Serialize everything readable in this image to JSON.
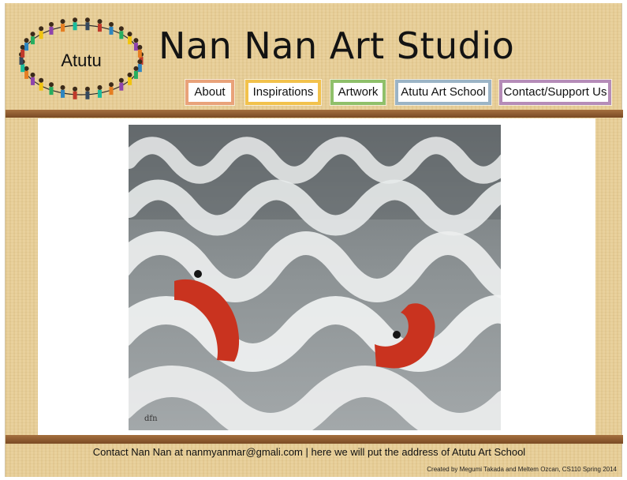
{
  "header": {
    "logo_text": "Atutu",
    "title": "Nan Nan Art Studio"
  },
  "nav": {
    "items": [
      {
        "label": "About",
        "color": "#e9a27a"
      },
      {
        "label": "Inspirations",
        "color": "#f2c24c"
      },
      {
        "label": "Artwork",
        "color": "#8fc06a"
      },
      {
        "label": "Atutu Art School",
        "color": "#9bb4c6"
      },
      {
        "label": "Contact/Support Us",
        "color": "#b58cb8"
      }
    ]
  },
  "main": {
    "artwork": "painting of waves with red shapes"
  },
  "footer": {
    "contact": "Contact Nan Nan at nanmyanmar@gmali.com | here we will put the address of Atutu Art School",
    "credit": "Created by Megumi Takada and Meltem Ozcan, CS110 Spring 2014"
  }
}
